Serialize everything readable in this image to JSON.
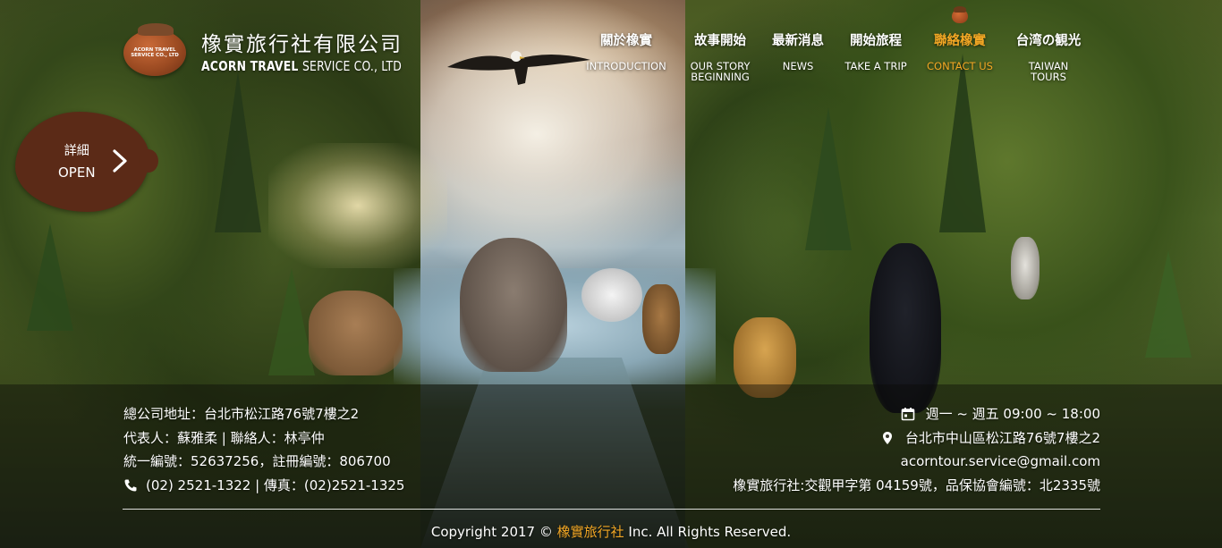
{
  "logo": {
    "badge_line1": "ACORN TRAVEL",
    "badge_line2": "SERVICE CO., LTD",
    "name_zh": "橡實旅行社有限公司",
    "name_en_bold": "ACORN TRAVEL ",
    "name_en_thin": "SERVICE CO., LTD"
  },
  "nav": {
    "items": [
      {
        "zh": "關於橡實",
        "en": "INTRODUCTION",
        "active": false
      },
      {
        "zh": "故事開始",
        "en": "OUR STORY\nBEGINNING",
        "active": false
      },
      {
        "zh": "最新消息",
        "en": "NEWS",
        "active": false
      },
      {
        "zh": "開始旅程",
        "en": "TAKE A TRIP",
        "active": false
      },
      {
        "zh": "聯絡橡實",
        "en": "CONTACT US",
        "active": true
      },
      {
        "zh": "台湾の観光",
        "en": "TAIWAN\nTOURS",
        "active": false
      }
    ],
    "active_color": "#f3a724"
  },
  "open_tab": {
    "label_zh": "詳細",
    "label_en": "OPEN",
    "icon": "chevron-right-icon"
  },
  "footer": {
    "address": "總公司地址：台北市松江路76號7樓之2",
    "representative": "代表人：蘇雅柔 | 聯絡人：林亭仲",
    "tax_id": "統一編號：52637256，註冊編號：806700",
    "phone_fax": "(02) 2521-1322 | 傳真：(02)2521-1325",
    "hours": "週一 ~ 週五 09:00 ~ 18:00",
    "location": "台北市中山區松江路76號7樓之2",
    "email": "acorntour.service@gmail.com",
    "license": "橡實旅行社:交觀甲字第 04159號，品保協會編號：北2335號",
    "copyright_prefix": "Copyright 2017 © ",
    "copyright_brand": "橡實旅行社",
    "copyright_suffix": " Inc. All Rights Reserved.",
    "icons": {
      "phone": "phone-icon",
      "calendar": "calendar-icon",
      "location": "location-pin-icon"
    }
  }
}
